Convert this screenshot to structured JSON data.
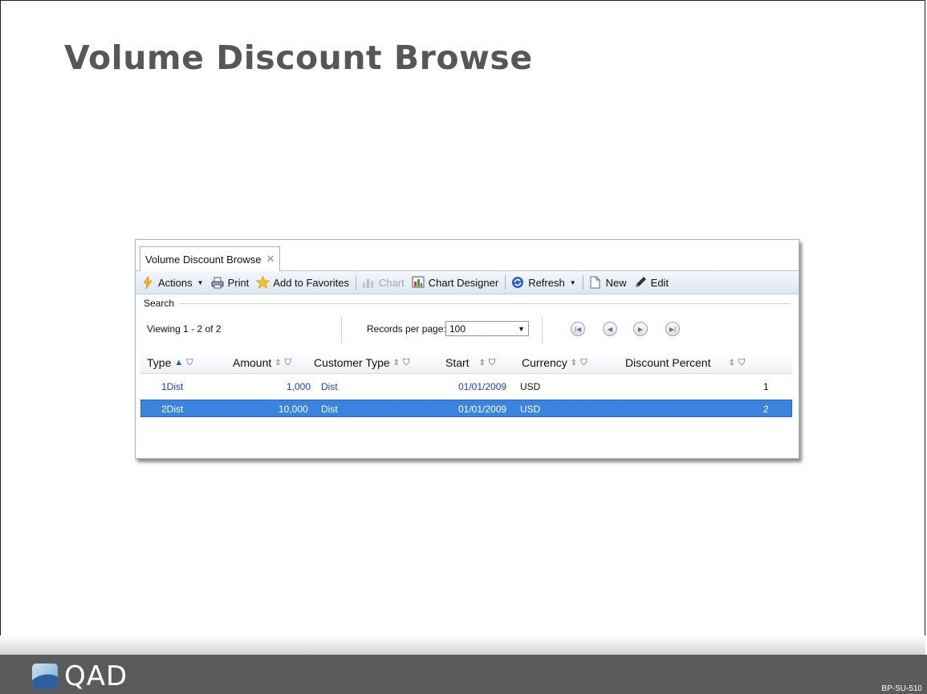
{
  "slide": {
    "title": "Volume Discount Browse",
    "footer_code": "BP-SU-510",
    "logo_text": "QAD"
  },
  "window": {
    "tab_label": "Volume Discount Browse",
    "tab_close": "✕"
  },
  "toolbar": {
    "actions": "Actions",
    "print": "Print",
    "favorites": "Add to Favorites",
    "chart": "Chart",
    "chart_designer": "Chart Designer",
    "refresh": "Refresh",
    "new": "New",
    "edit": "Edit"
  },
  "search": {
    "label": "Search"
  },
  "pager": {
    "viewing": "Viewing 1 - 2  of  2",
    "records_label": "Records per page:",
    "records_value": "100"
  },
  "grid": {
    "columns": [
      "Type",
      "Amount",
      "Customer Type",
      "Start",
      "Currency",
      "Discount Percent"
    ],
    "rows": [
      {
        "type": "1Dist",
        "amount": "1,000",
        "customer_type": "Dist",
        "start": "01/01/2009",
        "currency": "USD",
        "discount": "1"
      },
      {
        "type": "2Dist",
        "amount": "10,000",
        "customer_type": "Dist",
        "start": "01/01/2009",
        "currency": "USD",
        "discount": "2"
      }
    ]
  },
  "colors": {
    "selected_row": "#3a84e0",
    "link_text": "#1b3fcf",
    "footer_bar": "#5b5b5b",
    "title_text": "#575757"
  }
}
